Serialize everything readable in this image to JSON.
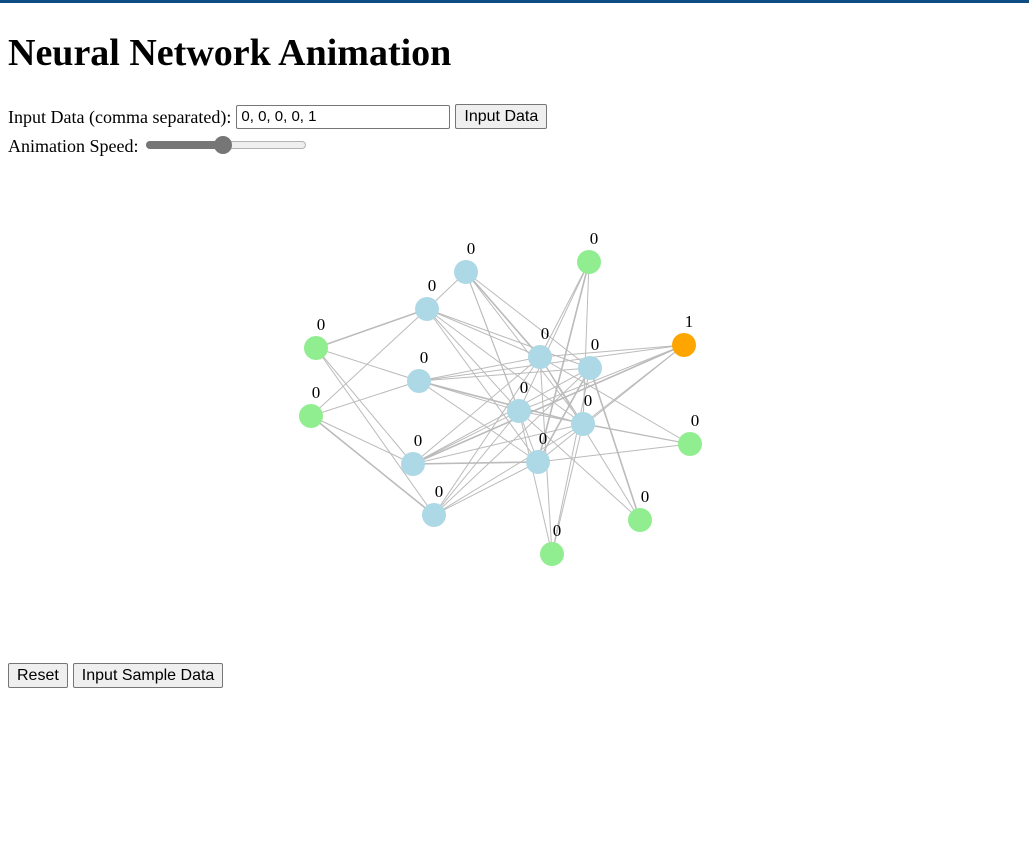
{
  "title": "Neural Network Animation",
  "input_row": {
    "label": "Input Data (comma separated):",
    "value": "0, 0, 0, 0, 1",
    "button_label": "Input Data"
  },
  "speed_row": {
    "label": "Animation Speed:",
    "value": 0.48
  },
  "buttons": {
    "reset_label": "Reset",
    "sample_label": "Input Sample Data"
  },
  "colors": {
    "input_node": "#90ee90",
    "hidden_node": "#add8e6",
    "active_node": "#ffa500",
    "link": "#bbbbbb"
  },
  "network": {
    "nodes": [
      {
        "id": "n1",
        "type": "input",
        "label": "0"
      },
      {
        "id": "n2",
        "type": "input",
        "label": "0"
      },
      {
        "id": "n3",
        "type": "hidden",
        "label": "0"
      },
      {
        "id": "n4",
        "type": "hidden",
        "label": "0"
      },
      {
        "id": "n5",
        "type": "hidden",
        "label": "0"
      },
      {
        "id": "n6",
        "type": "hidden",
        "label": "0"
      },
      {
        "id": "n7",
        "type": "hidden",
        "label": "0"
      },
      {
        "id": "n8",
        "type": "input",
        "label": "0"
      },
      {
        "id": "n9",
        "type": "hidden",
        "label": "0"
      },
      {
        "id": "n10",
        "type": "hidden",
        "label": "0"
      },
      {
        "id": "n11",
        "type": "active",
        "label": "1"
      },
      {
        "id": "n12",
        "type": "hidden",
        "label": "0"
      },
      {
        "id": "n13",
        "type": "hidden",
        "label": "0"
      },
      {
        "id": "n14",
        "type": "hidden",
        "label": "0"
      },
      {
        "id": "n15",
        "type": "input",
        "label": "0"
      },
      {
        "id": "n16",
        "type": "input",
        "label": "0"
      },
      {
        "id": "n17",
        "type": "input",
        "label": "0"
      }
    ]
  }
}
